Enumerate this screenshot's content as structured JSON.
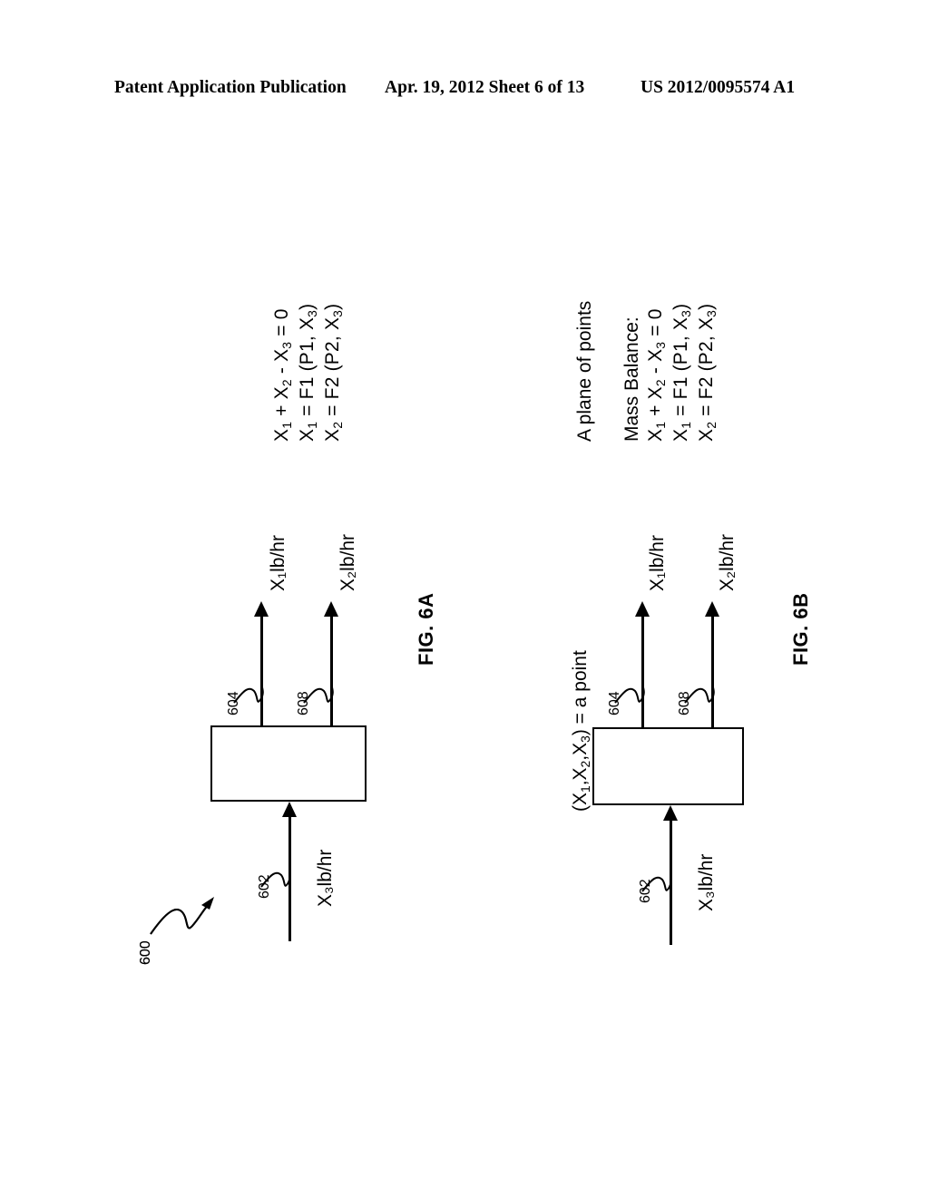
{
  "header": {
    "publication": "Patent Application Publication",
    "date_sheet": "Apr. 19, 2012  Sheet 6 of 13",
    "doc_number": "US 2012/0095574 A1"
  },
  "figures": [
    {
      "id": "fig-6a",
      "label": "FIG. 6A",
      "assembly_ref": "600",
      "equations": [
        "X₁ + X₂ - X₃ = 0",
        "X₁ = F1 (P1, X₃)",
        "X₂ = F2 (P2, X₃)"
      ],
      "equation_parts": [
        {
          "pre": "X",
          "sub1": "1",
          "mid": " + X",
          "sub2": "2",
          "mid2": " - X",
          "sub3": "3",
          "post": " = 0"
        },
        {
          "pre": "X",
          "sub1": "1",
          "mid": " = F1 (P1, X",
          "sub3": "3",
          "post": ")"
        },
        {
          "pre": "X",
          "sub1": "2",
          "mid": " = F2 (P2, X",
          "sub3": "3",
          "post": ")"
        }
      ],
      "streams": [
        {
          "ref": "604",
          "label": "X₁lb/hr",
          "direction": "out"
        },
        {
          "ref": "608",
          "label": "X₂lb/hr",
          "direction": "out"
        },
        {
          "ref": "602",
          "label": "X₃lb/hr",
          "direction": "in"
        }
      ],
      "annotations": []
    },
    {
      "id": "fig-6b",
      "label": "FIG. 6B",
      "assembly_ref": "600",
      "equations": [
        "X₁ + X₂ - X₃ = 0",
        "X₁ = F1 (P1, X₃)",
        "X₂ = F2 (P2, X₃)"
      ],
      "streams": [
        {
          "ref": "604",
          "label": "X₁lb/hr",
          "direction": "out"
        },
        {
          "ref": "608",
          "label": "X₂lb/hr",
          "direction": "out"
        },
        {
          "ref": "602",
          "label": "X₃lb/hr",
          "direction": "in"
        }
      ],
      "annotations": [
        "A plane of points",
        "Mass Balance:",
        "(X₁,X₂,X₃) = a point"
      ]
    }
  ],
  "colors": {
    "ink": "#000000",
    "paper": "#ffffff"
  }
}
